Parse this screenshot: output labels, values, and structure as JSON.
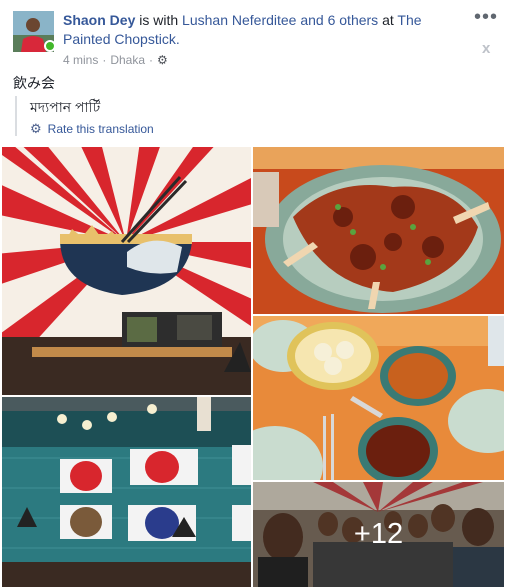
{
  "post": {
    "author": "Shaon Dey",
    "with_prefix": " is with ",
    "tagged": "Lushan Neferditee and 6 others",
    "at_prefix": " at ",
    "place": "The Painted Chopstick.",
    "time": "4 mins",
    "separator": "·",
    "location": "Dhaka",
    "text": "飲み会",
    "translation": "মদ্যপান পার্টি",
    "rate_translation": "Rate this translation",
    "more_label": "•••",
    "close_label": "x",
    "more_photos": "+12"
  },
  "colors": {
    "link": "#365899",
    "muted": "#90949c",
    "online": "#42b72a"
  },
  "icons": {
    "privacy": "gear-icon",
    "translation": "gear-icon"
  }
}
